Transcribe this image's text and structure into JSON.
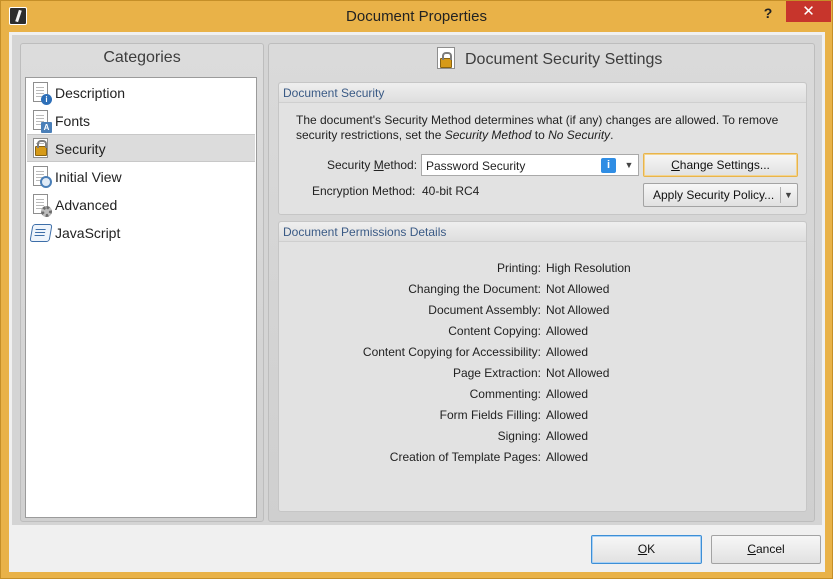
{
  "window": {
    "title": "Document Properties",
    "help_glyph": "?",
    "close_glyph": "✕"
  },
  "categories": {
    "header": "Categories",
    "items": [
      {
        "label": "Description",
        "icon": "doc-info-icon"
      },
      {
        "label": "Fonts",
        "icon": "doc-font-icon"
      },
      {
        "label": "Security",
        "icon": "lock-icon",
        "selected": true
      },
      {
        "label": "Initial View",
        "icon": "magnifier-icon"
      },
      {
        "label": "Advanced",
        "icon": "gear-icon"
      },
      {
        "label": "JavaScript",
        "icon": "script-icon"
      }
    ]
  },
  "panel": {
    "title": "Document Security Settings"
  },
  "security": {
    "group_title": "Document Security",
    "desc_pre": "The document's Security Method determines what (if any) changes are allowed. To remove security restrictions, set the ",
    "desc_em1": "Security Method",
    "desc_mid": " to ",
    "desc_em2": "No Security",
    "desc_post": ".",
    "method_label_a": "Security ",
    "method_label_u": "M",
    "method_label_b": "ethod:",
    "method_value": "Password Security",
    "encryption_label": "Encryption Method:",
    "encryption_value": "40-bit RC4",
    "change_btn_u": "C",
    "change_btn_rest": "hange Settings...",
    "policy_btn": "Apply Security Policy..."
  },
  "permissions": {
    "group_title": "Document Permissions Details",
    "rows": [
      {
        "label": "Printing:",
        "value": "High Resolution"
      },
      {
        "label": "Changing the Document:",
        "value": "Not Allowed"
      },
      {
        "label": "Document Assembly:",
        "value": "Not Allowed"
      },
      {
        "label": "Content Copying:",
        "value": "Allowed"
      },
      {
        "label": "Content Copying for Accessibility:",
        "value": "Allowed"
      },
      {
        "label": "Page Extraction:",
        "value": "Not Allowed"
      },
      {
        "label": "Commenting:",
        "value": "Allowed"
      },
      {
        "label": "Form Fields Filling:",
        "value": "Allowed"
      },
      {
        "label": "Signing:",
        "value": "Allowed"
      },
      {
        "label": "Creation of Template Pages:",
        "value": "Allowed"
      }
    ]
  },
  "footer": {
    "ok_u": "O",
    "ok_rest": "K",
    "cancel_u": "C",
    "cancel_rest": "ancel"
  },
  "colors": {
    "window_frame": "#e9b248",
    "close_button": "#c7352c",
    "group_title_text": "#3a5a85",
    "focus_border": "#e8b44c",
    "info_icon": "#2f8de4"
  }
}
